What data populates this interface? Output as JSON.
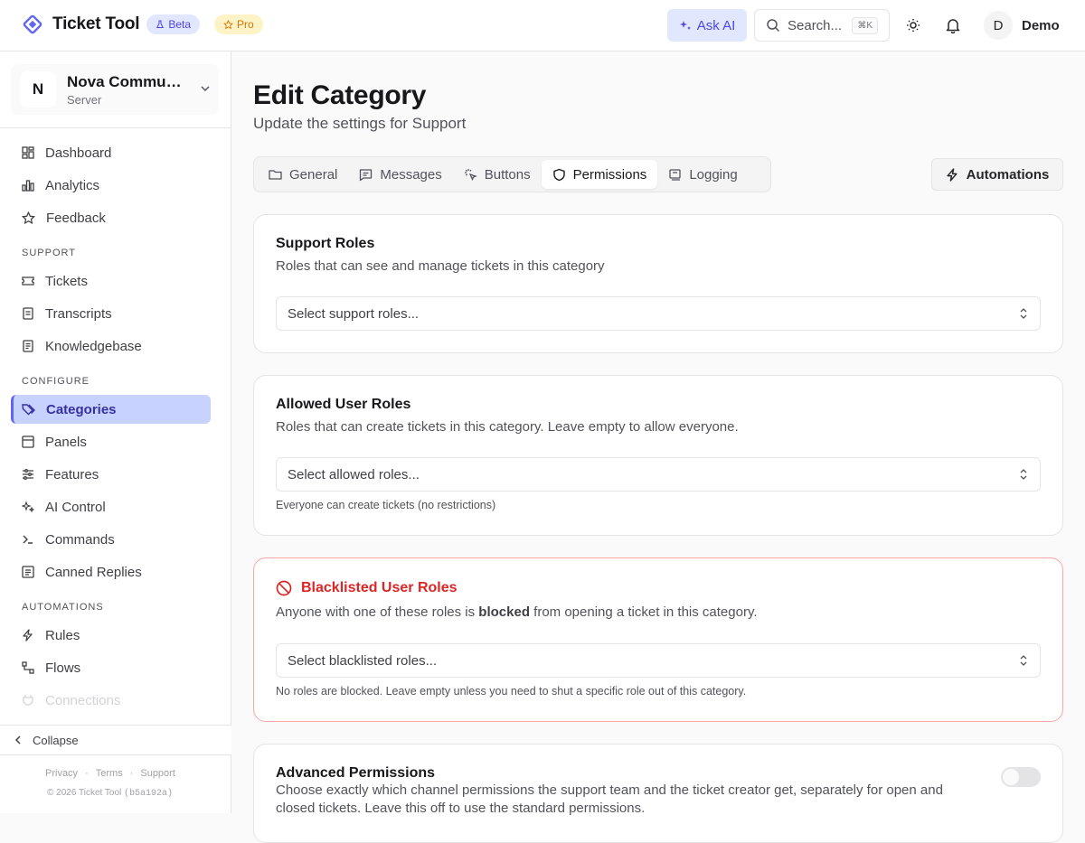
{
  "topbar": {
    "brand": "Ticket Tool",
    "beta_badge": "Beta",
    "pro_badge": "Pro",
    "ask_ai": "Ask AI",
    "search_placeholder": "Search...",
    "search_shortcut": "⌘K",
    "user_initial": "D",
    "user_name": "Demo",
    "accent": "#6366f1"
  },
  "sidebar": {
    "server_initial": "N",
    "server_name": "Nova Community",
    "server_sub": "Server",
    "items_main": [
      "Dashboard",
      "Analytics",
      "Feedback"
    ],
    "section_support": "SUPPORT",
    "items_support": [
      "Tickets",
      "Transcripts",
      "Knowledgebase"
    ],
    "section_configure": "CONFIGURE",
    "items_configure": [
      "Categories",
      "Panels",
      "Features",
      "AI Control",
      "Commands",
      "Canned Replies"
    ],
    "section_automations": "AUTOMATIONS",
    "items_automations": [
      "Rules",
      "Flows",
      "Connections"
    ],
    "collapse": "Collapse",
    "footer_privacy": "Privacy",
    "footer_terms": "Terms",
    "footer_support": "Support",
    "copyright": "© 2026 Ticket Tool",
    "build": "(b5a192a)"
  },
  "main": {
    "title": "Edit Category",
    "subtitle": "Update the settings for Support",
    "tabs": [
      "General",
      "Messages",
      "Buttons",
      "Permissions",
      "Logging"
    ],
    "active_tab": "Permissions",
    "automations_button": "Automations",
    "support_roles": {
      "title": "Support Roles",
      "desc": "Roles that can see and manage tickets in this category",
      "placeholder": "Select support roles..."
    },
    "allowed_roles": {
      "title": "Allowed User Roles",
      "desc": "Roles that can create tickets in this category. Leave empty to allow everyone.",
      "placeholder": "Select allowed roles...",
      "hint": "Everyone can create tickets (no restrictions)"
    },
    "blacklisted_roles": {
      "title": "Blacklisted User Roles",
      "desc_before": "Anyone with one of these roles is ",
      "desc_bold": "blocked",
      "desc_after": " from opening a ticket in this category.",
      "placeholder": "Select blacklisted roles...",
      "hint": "No roles are blocked. Leave empty unless you need to shut a specific role out of this category.",
      "color": "#dc2626"
    },
    "advanced": {
      "title": "Advanced Permissions",
      "desc": "Choose exactly which channel permissions the support team and the ticket creator get, separately for open and closed tickets. Leave this off to use the standard permissions.",
      "enabled": false
    }
  }
}
